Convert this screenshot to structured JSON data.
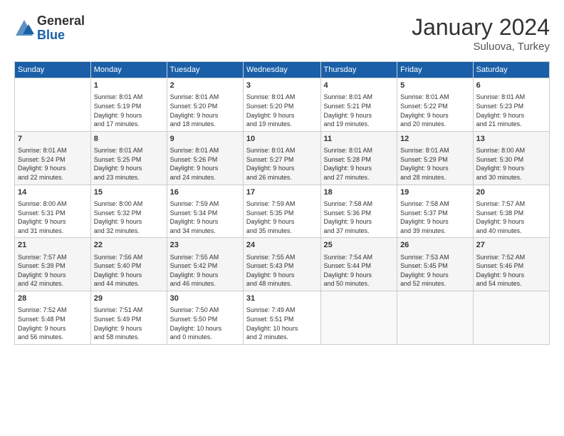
{
  "header": {
    "logo_general": "General",
    "logo_blue": "Blue",
    "month_title": "January 2024",
    "location": "Suluova, Turkey"
  },
  "days_of_week": [
    "Sunday",
    "Monday",
    "Tuesday",
    "Wednesday",
    "Thursday",
    "Friday",
    "Saturday"
  ],
  "weeks": [
    [
      {
        "day": "",
        "info": ""
      },
      {
        "day": "1",
        "info": "Sunrise: 8:01 AM\nSunset: 5:19 PM\nDaylight: 9 hours\nand 17 minutes."
      },
      {
        "day": "2",
        "info": "Sunrise: 8:01 AM\nSunset: 5:20 PM\nDaylight: 9 hours\nand 18 minutes."
      },
      {
        "day": "3",
        "info": "Sunrise: 8:01 AM\nSunset: 5:20 PM\nDaylight: 9 hours\nand 19 minutes."
      },
      {
        "day": "4",
        "info": "Sunrise: 8:01 AM\nSunset: 5:21 PM\nDaylight: 9 hours\nand 19 minutes."
      },
      {
        "day": "5",
        "info": "Sunrise: 8:01 AM\nSunset: 5:22 PM\nDaylight: 9 hours\nand 20 minutes."
      },
      {
        "day": "6",
        "info": "Sunrise: 8:01 AM\nSunset: 5:23 PM\nDaylight: 9 hours\nand 21 minutes."
      }
    ],
    [
      {
        "day": "7",
        "info": "Sunrise: 8:01 AM\nSunset: 5:24 PM\nDaylight: 9 hours\nand 22 minutes."
      },
      {
        "day": "8",
        "info": "Sunrise: 8:01 AM\nSunset: 5:25 PM\nDaylight: 9 hours\nand 23 minutes."
      },
      {
        "day": "9",
        "info": "Sunrise: 8:01 AM\nSunset: 5:26 PM\nDaylight: 9 hours\nand 24 minutes."
      },
      {
        "day": "10",
        "info": "Sunrise: 8:01 AM\nSunset: 5:27 PM\nDaylight: 9 hours\nand 26 minutes."
      },
      {
        "day": "11",
        "info": "Sunrise: 8:01 AM\nSunset: 5:28 PM\nDaylight: 9 hours\nand 27 minutes."
      },
      {
        "day": "12",
        "info": "Sunrise: 8:01 AM\nSunset: 5:29 PM\nDaylight: 9 hours\nand 28 minutes."
      },
      {
        "day": "13",
        "info": "Sunrise: 8:00 AM\nSunset: 5:30 PM\nDaylight: 9 hours\nand 30 minutes."
      }
    ],
    [
      {
        "day": "14",
        "info": "Sunrise: 8:00 AM\nSunset: 5:31 PM\nDaylight: 9 hours\nand 31 minutes."
      },
      {
        "day": "15",
        "info": "Sunrise: 8:00 AM\nSunset: 5:32 PM\nDaylight: 9 hours\nand 32 minutes."
      },
      {
        "day": "16",
        "info": "Sunrise: 7:59 AM\nSunset: 5:34 PM\nDaylight: 9 hours\nand 34 minutes."
      },
      {
        "day": "17",
        "info": "Sunrise: 7:59 AM\nSunset: 5:35 PM\nDaylight: 9 hours\nand 35 minutes."
      },
      {
        "day": "18",
        "info": "Sunrise: 7:58 AM\nSunset: 5:36 PM\nDaylight: 9 hours\nand 37 minutes."
      },
      {
        "day": "19",
        "info": "Sunrise: 7:58 AM\nSunset: 5:37 PM\nDaylight: 9 hours\nand 39 minutes."
      },
      {
        "day": "20",
        "info": "Sunrise: 7:57 AM\nSunset: 5:38 PM\nDaylight: 9 hours\nand 40 minutes."
      }
    ],
    [
      {
        "day": "21",
        "info": "Sunrise: 7:57 AM\nSunset: 5:39 PM\nDaylight: 9 hours\nand 42 minutes."
      },
      {
        "day": "22",
        "info": "Sunrise: 7:56 AM\nSunset: 5:40 PM\nDaylight: 9 hours\nand 44 minutes."
      },
      {
        "day": "23",
        "info": "Sunrise: 7:55 AM\nSunset: 5:42 PM\nDaylight: 9 hours\nand 46 minutes."
      },
      {
        "day": "24",
        "info": "Sunrise: 7:55 AM\nSunset: 5:43 PM\nDaylight: 9 hours\nand 48 minutes."
      },
      {
        "day": "25",
        "info": "Sunrise: 7:54 AM\nSunset: 5:44 PM\nDaylight: 9 hours\nand 50 minutes."
      },
      {
        "day": "26",
        "info": "Sunrise: 7:53 AM\nSunset: 5:45 PM\nDaylight: 9 hours\nand 52 minutes."
      },
      {
        "day": "27",
        "info": "Sunrise: 7:52 AM\nSunset: 5:46 PM\nDaylight: 9 hours\nand 54 minutes."
      }
    ],
    [
      {
        "day": "28",
        "info": "Sunrise: 7:52 AM\nSunset: 5:48 PM\nDaylight: 9 hours\nand 56 minutes."
      },
      {
        "day": "29",
        "info": "Sunrise: 7:51 AM\nSunset: 5:49 PM\nDaylight: 9 hours\nand 58 minutes."
      },
      {
        "day": "30",
        "info": "Sunrise: 7:50 AM\nSunset: 5:50 PM\nDaylight: 10 hours\nand 0 minutes."
      },
      {
        "day": "31",
        "info": "Sunrise: 7:49 AM\nSunset: 5:51 PM\nDaylight: 10 hours\nand 2 minutes."
      },
      {
        "day": "",
        "info": ""
      },
      {
        "day": "",
        "info": ""
      },
      {
        "day": "",
        "info": ""
      }
    ]
  ]
}
